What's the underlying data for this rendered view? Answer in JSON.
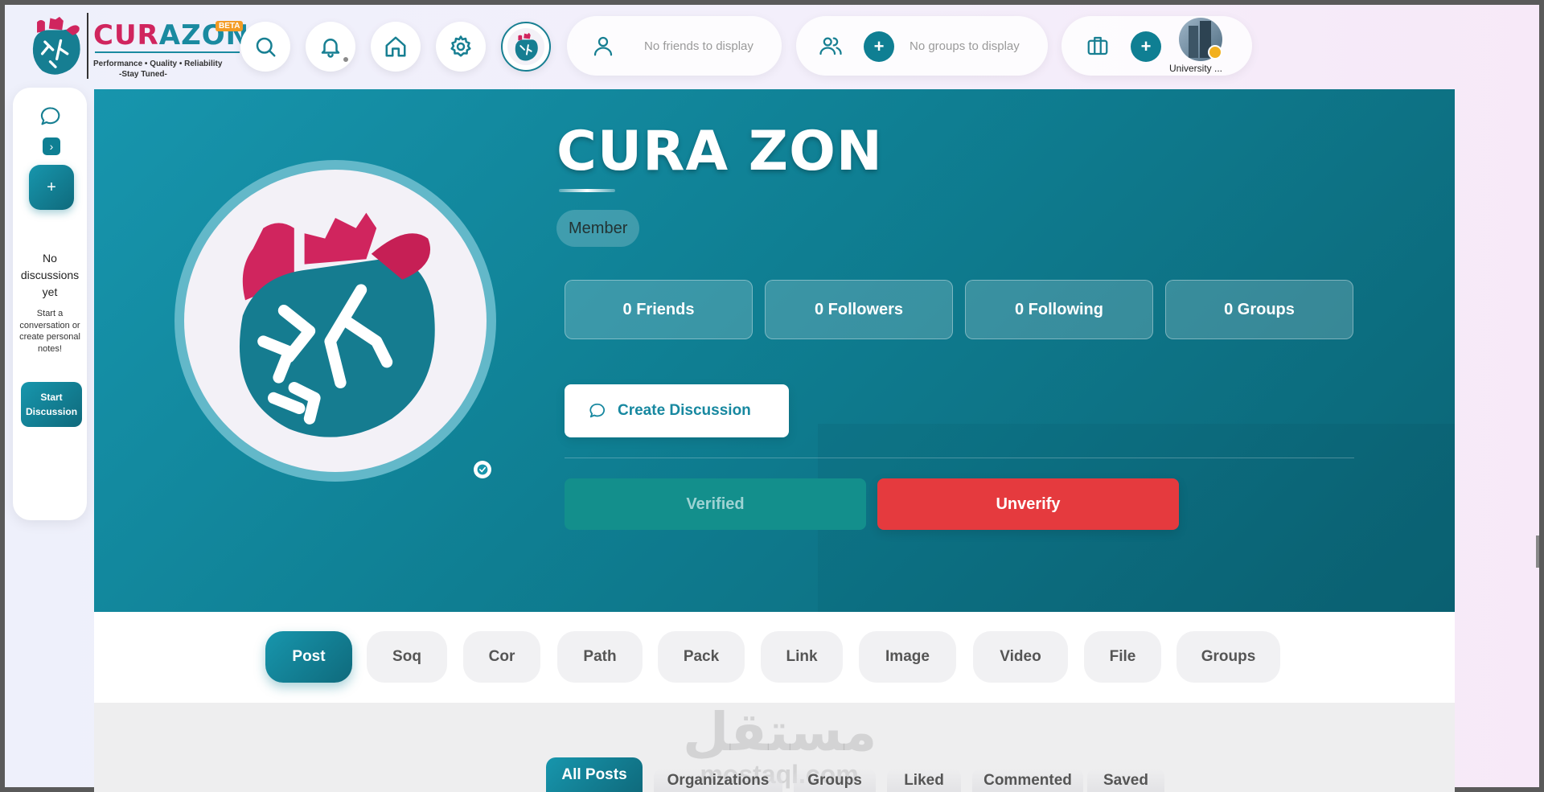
{
  "brand": {
    "name_a": "CUR",
    "name_b": "AZON",
    "beta": "BETA",
    "tagline": "Performance • Quality • Reliability",
    "tagline2": "-Stay Tuned-",
    "primary_color": "#0f7f93",
    "accent_color": "#d0255e"
  },
  "topbar": {
    "friends": {
      "empty_text": "No friends to display",
      "icon": "user-icon"
    },
    "groups": {
      "empty_text": "No groups to display",
      "icon": "users-icon"
    },
    "organization": {
      "label": "University ...",
      "icon": "briefcase-icon"
    }
  },
  "sidebar": {
    "empty_title": "No discussions yet",
    "empty_desc": "Start a conversation or create personal notes!",
    "start_button": "Start Discussion",
    "add_label": "+",
    "expand_label": "›"
  },
  "profile": {
    "name": "CURA ZON",
    "role": "Member",
    "stats": [
      {
        "label": "0 Friends"
      },
      {
        "label": "0 Followers"
      },
      {
        "label": "0 Following"
      },
      {
        "label": "0 Groups"
      }
    ],
    "create_discussion": "Create Discussion",
    "verified_label": "Verified",
    "unverify_label": "Unverify",
    "unverify_color": "#e53a3e"
  },
  "tabs": [
    "Post",
    "Soq",
    "Cor",
    "Path",
    "Pack",
    "Link",
    "Image",
    "Video",
    "File",
    "Groups"
  ],
  "active_tab": "Post",
  "subtabs": [
    "All Posts",
    "Organizations",
    "Groups",
    "Liked",
    "Commented",
    "Saved"
  ],
  "active_subtab": "All Posts",
  "watermark": {
    "arabic": "مستقل",
    "latin": "mostaql.com"
  }
}
